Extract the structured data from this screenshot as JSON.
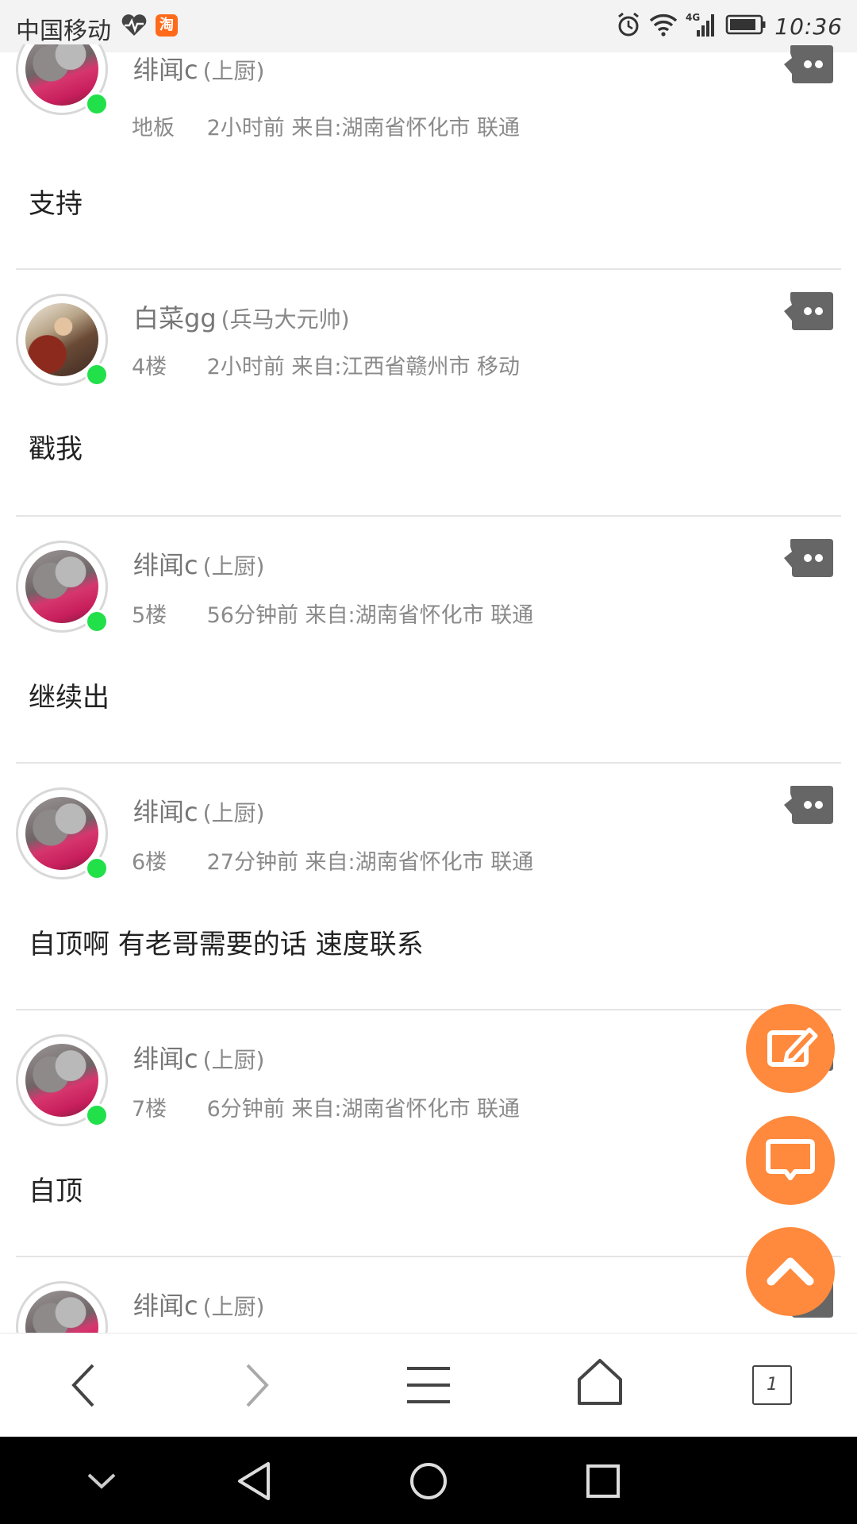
{
  "status_bar": {
    "carrier": "中国移动",
    "network": "4G",
    "time": "10:36",
    "app_badge": "淘"
  },
  "posts": [
    {
      "username": "绯闻c",
      "title": "(上厨)",
      "floor": "地板",
      "time": "2小时前",
      "source": "来自:湖南省怀化市 联通",
      "content": "支持",
      "avatar": "cat"
    },
    {
      "username": "白菜gg",
      "title": "(兵马大元帅)",
      "floor": "4楼",
      "time": "2小时前",
      "source": "来自:江西省赣州市 移动",
      "content": "戳我",
      "avatar": "warrior"
    },
    {
      "username": "绯闻c",
      "title": "(上厨)",
      "floor": "5楼",
      "time": "56分钟前",
      "source": "来自:湖南省怀化市 联通",
      "content": "继续出",
      "avatar": "cat"
    },
    {
      "username": "绯闻c",
      "title": "(上厨)",
      "floor": "6楼",
      "time": "27分钟前",
      "source": "来自:湖南省怀化市 联通",
      "content": "自顶啊 有老哥需要的话 速度联系",
      "avatar": "cat"
    },
    {
      "username": "绯闻c",
      "title": "(上厨)",
      "floor": "7楼",
      "time": "6分钟前",
      "source": "来自:湖南省怀化市 联通",
      "content": "自顶",
      "avatar": "cat"
    },
    {
      "username": "绯闻c",
      "title": "(上厨)",
      "floor": "",
      "time": "",
      "source": "",
      "content": "",
      "avatar": "cat"
    }
  ],
  "fab": {
    "edit": "edit-icon",
    "comment": "comment-icon",
    "top": "chevron-up-icon",
    "color": "#ff8a3d"
  },
  "toolbar": {
    "tab_count": "1"
  },
  "colors": {
    "online": "#22e04a",
    "accent": "#ff8a3d",
    "reply_icon": "#666666"
  }
}
